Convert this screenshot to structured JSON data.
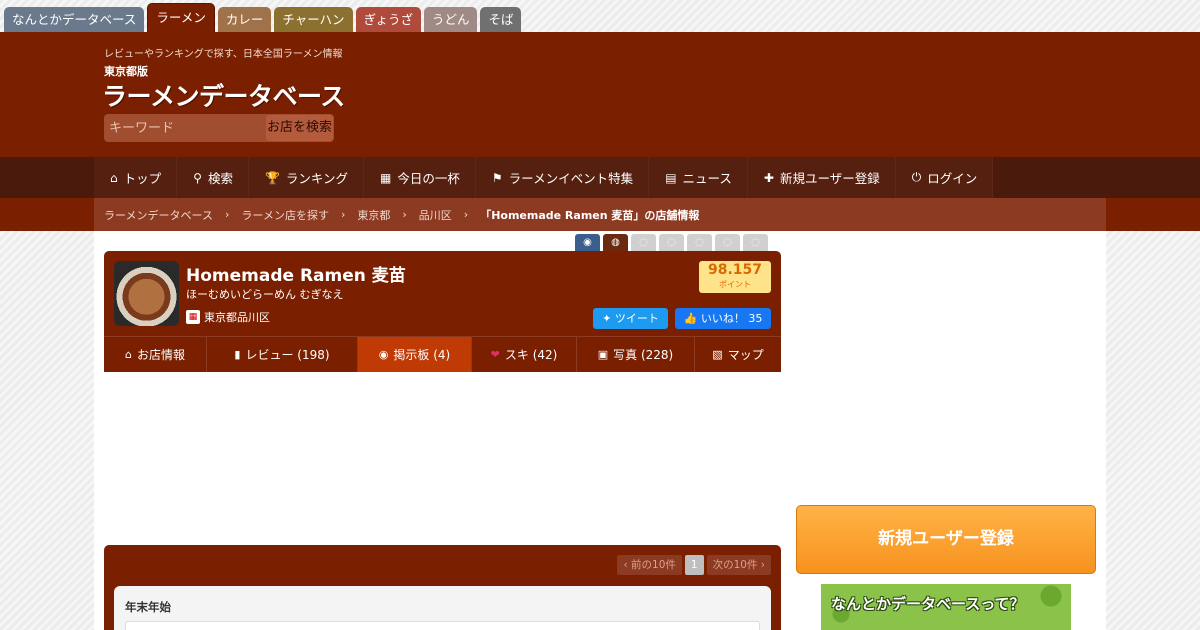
{
  "top_tabs": [
    {
      "label": "なんとかデータベース",
      "color": "#6a7a8c"
    },
    {
      "label": "ラーメン",
      "color": "#7a1f00",
      "active": true
    },
    {
      "label": "カレー",
      "color": "#a0724a"
    },
    {
      "label": "チャーハン",
      "color": "#8c7030"
    },
    {
      "label": "ぎょうざ",
      "color": "#b04a3a"
    },
    {
      "label": "うどん",
      "color": "#a08a86"
    },
    {
      "label": "そば",
      "color": "#707070"
    }
  ],
  "header": {
    "tagline": "レビューやランキングで探す、日本全国ラーメン情報",
    "logo_small": "東京都版",
    "logo_big": "ラーメンデータベース",
    "search_placeholder": "キーワード",
    "search_button": "お店を検索"
  },
  "nav": [
    {
      "icon": "⌂",
      "label": "トップ",
      "icon_name": "home-icon"
    },
    {
      "icon": "⚲",
      "label": "検索",
      "icon_name": "search-icon"
    },
    {
      "icon": "🏆",
      "label": "ランキング",
      "icon_name": "trophy-icon"
    },
    {
      "icon": "▦",
      "label": "今日の一杯",
      "icon_name": "calendar-icon"
    },
    {
      "icon": "⚑",
      "label": "ラーメンイベント特集",
      "icon_name": "megaphone-icon"
    },
    {
      "icon": "▤",
      "label": "ニュース",
      "icon_name": "news-icon"
    },
    {
      "icon": "✚",
      "label": "新規ユーザー登録",
      "icon_name": "user-plus-icon"
    },
    {
      "icon": "⏻",
      "label": "ログイン",
      "icon_name": "power-icon"
    }
  ],
  "breadcrumb": [
    "ラーメンデータベース",
    "ラーメン店を探す",
    "東京都",
    "品川区",
    "「Homemade Ramen 麦苗」の店舗情報"
  ],
  "shop": {
    "name": "Homemade Ramen 麦苗",
    "kana": "ほーむめいどらーめん むぎなえ",
    "location": "東京都品川区",
    "points_value": "98.157",
    "points_unit": "ポイント",
    "tweet_label": "ツイート",
    "like_label": "いいね！ 35"
  },
  "shop_tabs": [
    {
      "icon": "⌂",
      "label": "お店情報",
      "icon_name": "shop-icon"
    },
    {
      "icon": "▮",
      "label": "レビュー (198)",
      "icon_name": "clipboard-icon"
    },
    {
      "icon": "◉",
      "label": "掲示板 (4)",
      "icon_name": "speech-bubble-icon",
      "active": true
    },
    {
      "icon": "❤",
      "label": "スキ (42)",
      "icon_name": "heart-icon"
    },
    {
      "icon": "▣",
      "label": "写真 (228)",
      "icon_name": "camera-icon"
    },
    {
      "icon": "▧",
      "label": "マップ",
      "icon_name": "map-icon"
    }
  ],
  "board": {
    "prev_label": "前の10件",
    "page": "1",
    "next_label": "次の10件",
    "post_title": "年末年始"
  },
  "sidebar": {
    "register_button": "新規ユーザー登録",
    "promo_text": "なんとかデータベースって？"
  }
}
